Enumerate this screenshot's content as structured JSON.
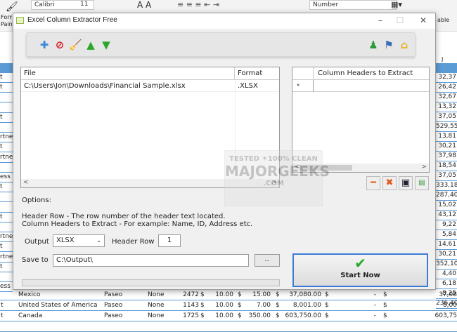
{
  "ribbon": {
    "font": "Calibri",
    "size": "11",
    "number_format": "Number",
    "format_painter": "Format Painter",
    "table": "able"
  },
  "sheet": {
    "col_header": "J",
    "left_fragments": [
      "t",
      "t",
      "",
      "",
      "t",
      "",
      "rtner",
      "t",
      "rtner",
      "",
      "ess",
      "t",
      "",
      "",
      "t",
      "",
      "rtner",
      "t",
      "rtner",
      "t",
      "",
      "ess"
    ],
    "right_values": [
      "32,37",
      "26,42",
      "32,67",
      "13,32",
      "37,05",
      "529,55",
      "13,81",
      "30,21",
      "37,98",
      "18,54",
      "37,05",
      "333,18",
      "287,40",
      "15,02",
      "43,12",
      "9,22",
      "5,84",
      "14,61",
      "30,21",
      "352,10",
      "4,40",
      "6,18",
      "8,25",
      "236,40"
    ],
    "bottom_rows": [
      {
        "seg": "",
        "country": "Mexico",
        "product": "Paseo",
        "discount": "None",
        "units": "2472",
        "price": "10.00",
        "sale": "15.00",
        "gross": "37,080.00",
        "disc": "-",
        "net": "37,08"
      },
      {
        "seg": "t",
        "country": "United States of America",
        "product": "Paseo",
        "discount": "None",
        "units": "1143",
        "price": "10.00",
        "sale": "7.00",
        "gross": "8,001.00",
        "disc": "-",
        "net": "8,00"
      },
      {
        "seg": "t",
        "country": "Canada",
        "product": "Paseo",
        "discount": "None",
        "units": "1725",
        "price": "10.00",
        "sale": "350.00",
        "gross": "603,750.00",
        "disc": "-",
        "net": "603,75"
      }
    ],
    "currency": "$"
  },
  "dialog": {
    "title": "Excel Column Extractor Free",
    "toolbar": [
      "add-icon",
      "remove-icon",
      "clear-icon",
      "move-up-icon",
      "move-down-icon",
      "user-icon",
      "flag-icon",
      "home-icon"
    ],
    "files": {
      "col_file": "File",
      "col_format": "Format",
      "rows": [
        {
          "file": "C:\\Users\\Jon\\Downloads\\Financial Sample.xlsx",
          "format": ".XLSX"
        }
      ]
    },
    "headers": {
      "col": "Column Headers to Extract",
      "new_row_marker": "*"
    },
    "options_label": "Options:",
    "help1": "Header Row - The row number of the header text located.",
    "help2": "Column Headers to Extract - For example: Name, ID, Address etc.",
    "output_label": "Output",
    "output_value": "XLSX",
    "header_row_label": "Header Row",
    "header_row_value": "1",
    "save_to_label": "Save to",
    "save_to_value": "C:\\Output\\",
    "browse_label": "...",
    "start_label": "Start Now",
    "progress": 0,
    "watermark": "TESTED 100% CLEAN MAJORGEEKS .COM"
  }
}
